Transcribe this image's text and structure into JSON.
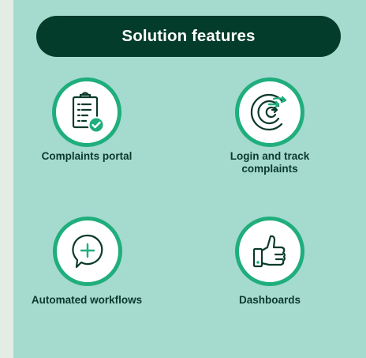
{
  "header": {
    "title": "Solution features"
  },
  "features": [
    {
      "label": "Complaints portal",
      "icon": "clipboard-checklist-icon"
    },
    {
      "label": "Login and track complaints",
      "label_line1": "Login and track",
      "label_line2": "complaints",
      "icon": "tracking-arrows-icon"
    },
    {
      "label": "Automated workflows",
      "icon": "chat-plus-icon"
    },
    {
      "label": "Dashboards",
      "icon": "thumbs-up-icon"
    }
  ],
  "colors": {
    "background": "#e4ece6",
    "panel": "#a5dacf",
    "header_pill": "#033c2a",
    "circle_ring": "#1fae7c",
    "icon_stroke": "#0b3a2b",
    "accent_green": "#1fae7c"
  }
}
